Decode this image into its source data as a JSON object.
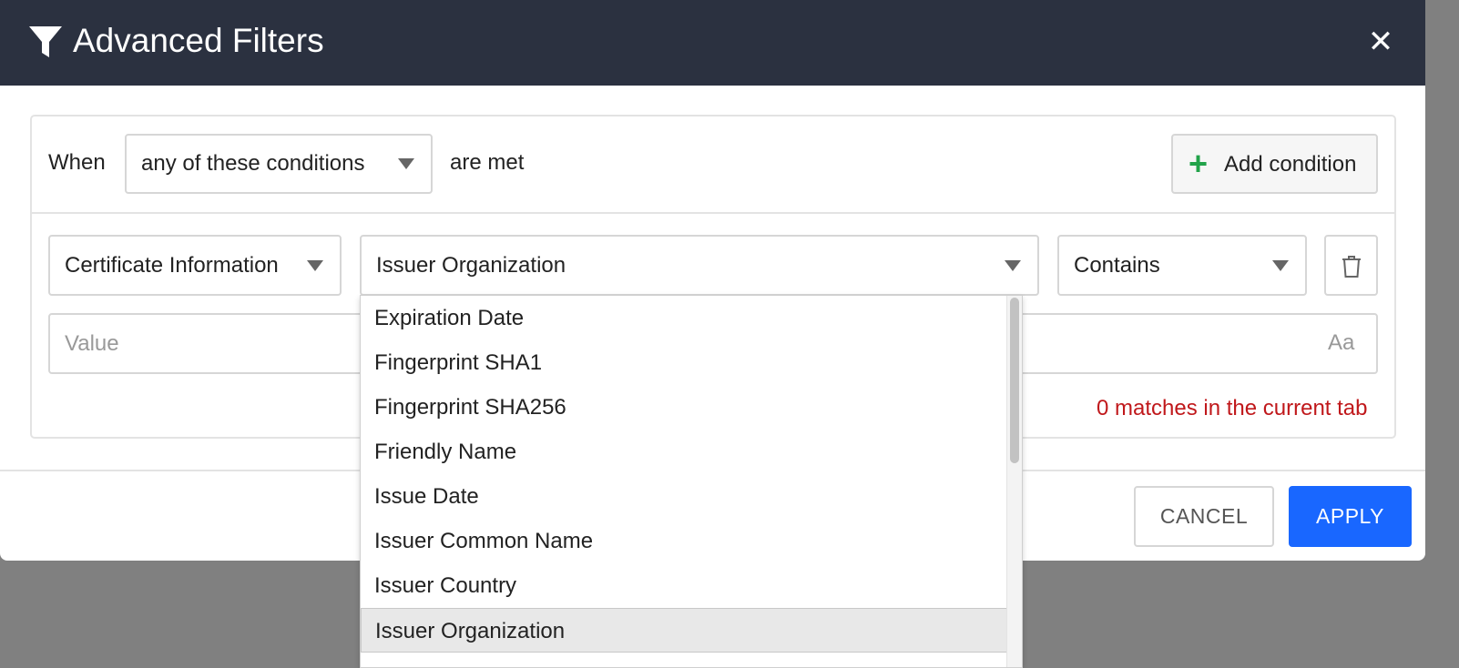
{
  "header": {
    "title": "Advanced Filters",
    "filter_icon": "filter-icon",
    "close_icon": "close-icon",
    "close_glyph": "✕"
  },
  "match_row": {
    "prefix": "When",
    "mode_selected": "any of these conditions",
    "suffix": "are met",
    "add_button_label": "Add condition",
    "add_glyph": "+"
  },
  "condition": {
    "category_selected": "Certificate Information",
    "field_selected": "Issuer Organization",
    "operator_selected": "Contains",
    "value_placeholder": "Value",
    "value": "",
    "case_icon_label": "Aa",
    "delete_icon": "trash-icon"
  },
  "status": {
    "matches_text": "0 matches in the current tab",
    "color": "#c0181b"
  },
  "dropdown": {
    "options": [
      "Expiration Date",
      "Fingerprint SHA1",
      "Fingerprint SHA256",
      "Friendly Name",
      "Issue Date",
      "Issuer Common Name",
      "Issuer Country",
      "Issuer Organization"
    ],
    "selected": "Issuer Organization"
  },
  "footer": {
    "cancel_label": "CANCEL",
    "apply_label": "APPLY"
  },
  "colors": {
    "header_bg": "#2b3140",
    "apply_bg": "#1967ff",
    "add_plus": "#22a34a"
  }
}
